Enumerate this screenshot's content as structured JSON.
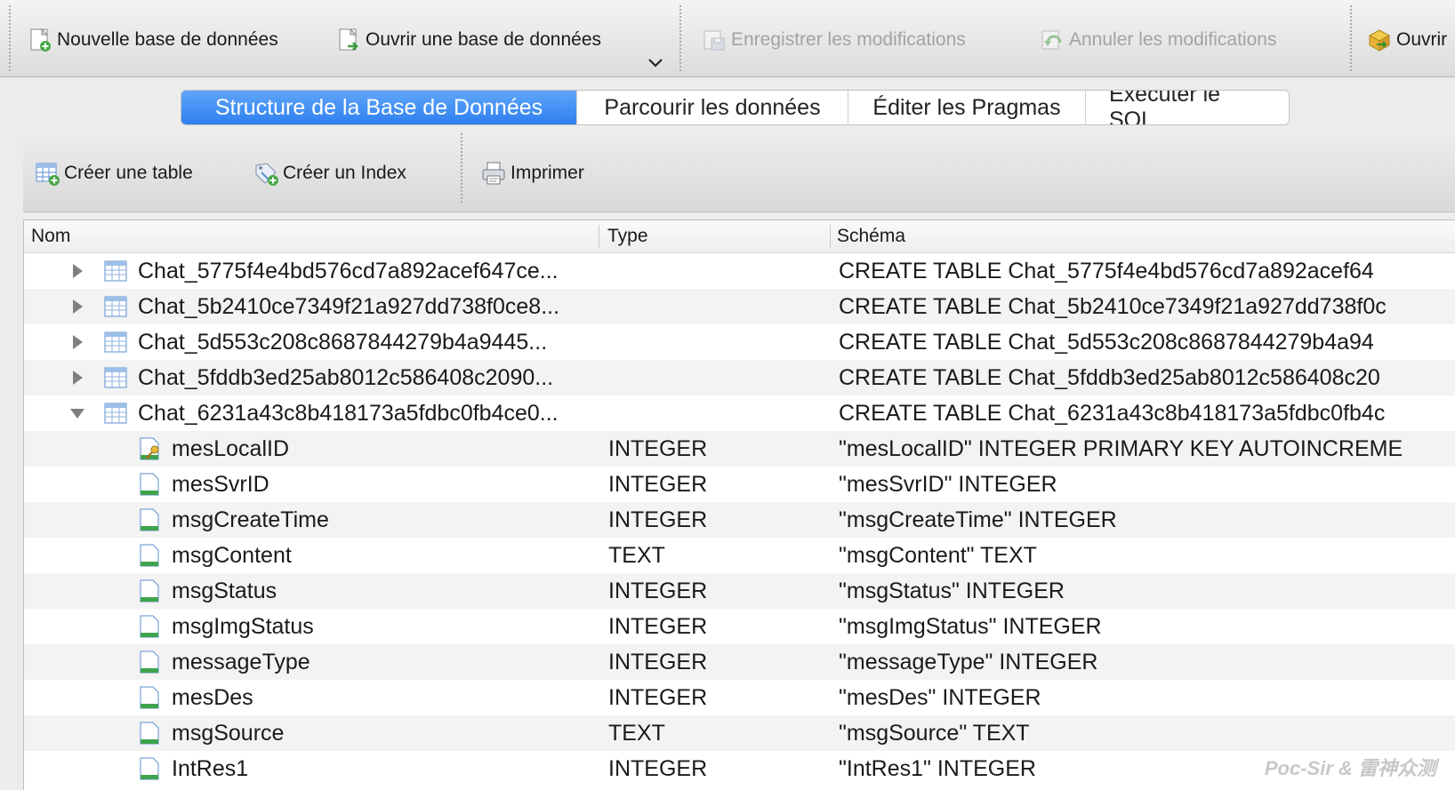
{
  "toolbar": {
    "new_db": "Nouvelle base de données",
    "open_db": "Ouvrir une base de données",
    "save": "Enregistrer les modifications",
    "revert": "Annuler les modifications",
    "open_project": "Ouvrir"
  },
  "tabs": [
    {
      "label": "Structure de la Base de Données",
      "active": true
    },
    {
      "label": "Parcourir les données",
      "active": false
    },
    {
      "label": "Éditer les Pragmas",
      "active": false
    },
    {
      "label": "Exécuter le SQL",
      "active": false
    }
  ],
  "structure_toolbar": {
    "create_table": "Créer une table",
    "create_index": "Créer un Index",
    "print": "Imprimer"
  },
  "tree": {
    "columns": {
      "name": "Nom",
      "type": "Type",
      "schema": "Schéma"
    },
    "rows": [
      {
        "kind": "table",
        "expand": "collapsed",
        "name": "Chat_5775f4e4bd576cd7a892acef647ce...",
        "type": "",
        "schema": "CREATE TABLE Chat_5775f4e4bd576cd7a892acef64"
      },
      {
        "kind": "table",
        "expand": "collapsed",
        "name": "Chat_5b2410ce7349f21a927dd738f0ce8...",
        "type": "",
        "schema": "CREATE TABLE Chat_5b2410ce7349f21a927dd738f0c"
      },
      {
        "kind": "table",
        "expand": "collapsed",
        "name": "Chat_5d553c208c8687844279b4a9445...",
        "type": "",
        "schema": "CREATE TABLE Chat_5d553c208c8687844279b4a94"
      },
      {
        "kind": "table",
        "expand": "collapsed",
        "name": "Chat_5fddb3ed25ab8012c586408c2090...",
        "type": "",
        "schema": "CREATE TABLE Chat_5fddb3ed25ab8012c586408c20"
      },
      {
        "kind": "table",
        "expand": "expanded",
        "name": "Chat_6231a43c8b418173a5fdbc0fb4ce0...",
        "type": "",
        "schema": "CREATE TABLE Chat_6231a43c8b418173a5fdbc0fb4c"
      },
      {
        "kind": "key",
        "expand": "none",
        "name": "mesLocalID",
        "type": "INTEGER",
        "schema": "\"mesLocalID\" INTEGER PRIMARY KEY AUTOINCREME"
      },
      {
        "kind": "field",
        "expand": "none",
        "name": "mesSvrID",
        "type": "INTEGER",
        "schema": "\"mesSvrID\" INTEGER"
      },
      {
        "kind": "field",
        "expand": "none",
        "name": "msgCreateTime",
        "type": "INTEGER",
        "schema": "\"msgCreateTime\" INTEGER"
      },
      {
        "kind": "field",
        "expand": "none",
        "name": "msgContent",
        "type": "TEXT",
        "schema": "\"msgContent\" TEXT"
      },
      {
        "kind": "field",
        "expand": "none",
        "name": "msgStatus",
        "type": "INTEGER",
        "schema": "\"msgStatus\" INTEGER"
      },
      {
        "kind": "field",
        "expand": "none",
        "name": "msgImgStatus",
        "type": "INTEGER",
        "schema": "\"msgImgStatus\" INTEGER"
      },
      {
        "kind": "field",
        "expand": "none",
        "name": "messageType",
        "type": "INTEGER",
        "schema": "\"messageType\" INTEGER"
      },
      {
        "kind": "field",
        "expand": "none",
        "name": "mesDes",
        "type": "INTEGER",
        "schema": "\"mesDes\" INTEGER"
      },
      {
        "kind": "field",
        "expand": "none",
        "name": "msgSource",
        "type": "TEXT",
        "schema": "\"msgSource\" TEXT"
      },
      {
        "kind": "field",
        "expand": "none",
        "name": "IntRes1",
        "type": "INTEGER",
        "schema": "\"IntRes1\" INTEGER"
      }
    ]
  },
  "watermark": "Poc-Sir & 雷神众测",
  "colors": {
    "accent": "#3a86f2",
    "table_icon": "#5b8fd1",
    "field_icon": "#3fa34d"
  }
}
